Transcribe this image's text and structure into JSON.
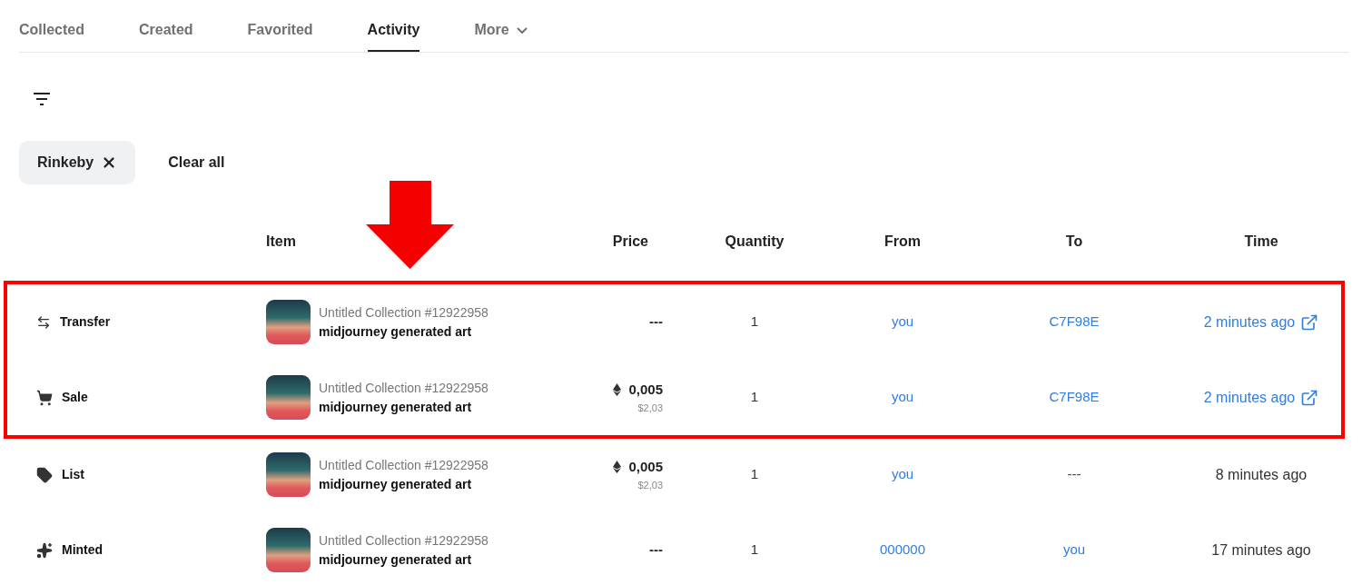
{
  "tabs": [
    {
      "label": "Collected",
      "selected": false
    },
    {
      "label": "Created",
      "selected": false
    },
    {
      "label": "Favorited",
      "selected": false
    },
    {
      "label": "Activity",
      "selected": true
    },
    {
      "label": "More",
      "selected": false,
      "dropdown": true
    }
  ],
  "filters": {
    "chips": [
      "Rinkeby"
    ],
    "clear_label": "Clear all"
  },
  "table": {
    "columns": [
      "",
      "Item",
      "Price",
      "Quantity",
      "From",
      "To",
      "Time"
    ],
    "rows": [
      {
        "kind": "transfer",
        "event": "Transfer",
        "highlighted": true,
        "collection": "Untitled Collection #12922958",
        "name": "midjourney generated art",
        "price": "---",
        "quantity": "1",
        "from": {
          "text": "you",
          "linked": true
        },
        "to": {
          "text": "C7F98E",
          "linked": true
        },
        "time": {
          "text": "2 minutes ago",
          "linked": true
        }
      },
      {
        "kind": "sale",
        "event": "Sale",
        "highlighted": true,
        "collection": "Untitled Collection #12922958",
        "name": "midjourney generated art",
        "price": "0,005",
        "usd": "$2,03",
        "quantity": "1",
        "from": {
          "text": "you",
          "linked": true
        },
        "to": {
          "text": "C7F98E",
          "linked": true
        },
        "time": {
          "text": "2 minutes ago",
          "linked": true
        }
      },
      {
        "kind": "list",
        "event": "List",
        "highlighted": false,
        "collection": "Untitled Collection #12922958",
        "name": "midjourney generated art",
        "price": "0,005",
        "usd": "$2,03",
        "quantity": "1",
        "from": {
          "text": "you",
          "linked": true
        },
        "to": {
          "text": "---",
          "linked": false
        },
        "time": {
          "text": "8 minutes ago",
          "linked": false
        }
      },
      {
        "kind": "minted",
        "event": "Minted",
        "highlighted": false,
        "collection": "Untitled Collection #12922958",
        "name": "midjourney generated art",
        "price": "---",
        "quantity": "1",
        "from": {
          "text": "000000",
          "linked": true
        },
        "to": {
          "text": "you",
          "linked": true
        },
        "time": {
          "text": "17 minutes ago",
          "linked": false
        }
      }
    ]
  }
}
